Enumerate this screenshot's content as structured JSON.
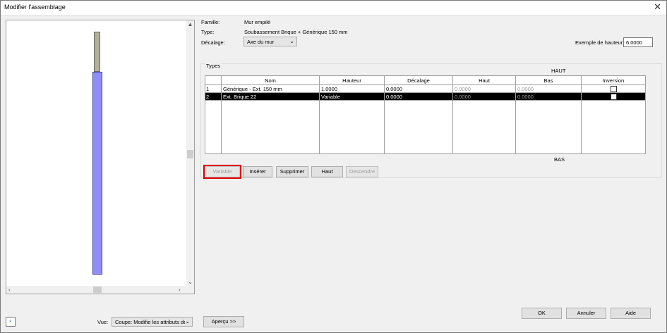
{
  "window": {
    "title": "Modifier l'assemblage"
  },
  "properties": {
    "famille_label": "Famille:",
    "famille_value": "Mur empilé",
    "type_label": "Type:",
    "type_value": "Soubassement Brique + Générique 150 mm",
    "decalage_label": "Décalage:",
    "decalage_value": "Axe du mur",
    "hauteur_label": "Exemple de hauteur:",
    "hauteur_value": "6.0000"
  },
  "types_group": {
    "label": "Types",
    "haut_caption": "HAUT",
    "bas_caption": "BAS",
    "columns": [
      "",
      "Nom",
      "Hauteur",
      "Décalage",
      "Haut",
      "Bas",
      "Inversion"
    ],
    "rows": [
      {
        "num": "1",
        "nom": "Générique - Ext. 150 mm",
        "hauteur": "1.0000",
        "decalage": "0.0000",
        "haut": "0.0000",
        "bas": "0.0000"
      },
      {
        "num": "2",
        "nom": "Ext. Brique 22",
        "hauteur": "Variable",
        "decalage": "0.0000",
        "haut": "0.0000",
        "bas": "0.0000"
      }
    ]
  },
  "buttons": {
    "variable": "Variable",
    "inserer": "Insérer",
    "supprimer": "Supprimer",
    "haut": "Haut",
    "descendre": "Descendre",
    "ok": "OK",
    "annuler": "Annuler",
    "aide": "Aide",
    "apercu": "Aperçu >>"
  },
  "footer": {
    "vue_label": "Vue:",
    "vue_value": "Coupe: Modifie les attributs des"
  },
  "colors": {
    "selected_row_bg": "#000000",
    "highlight_outline": "#e00000",
    "wall_upper": "#b5b09a",
    "wall_lower": "#8e8ef5"
  }
}
